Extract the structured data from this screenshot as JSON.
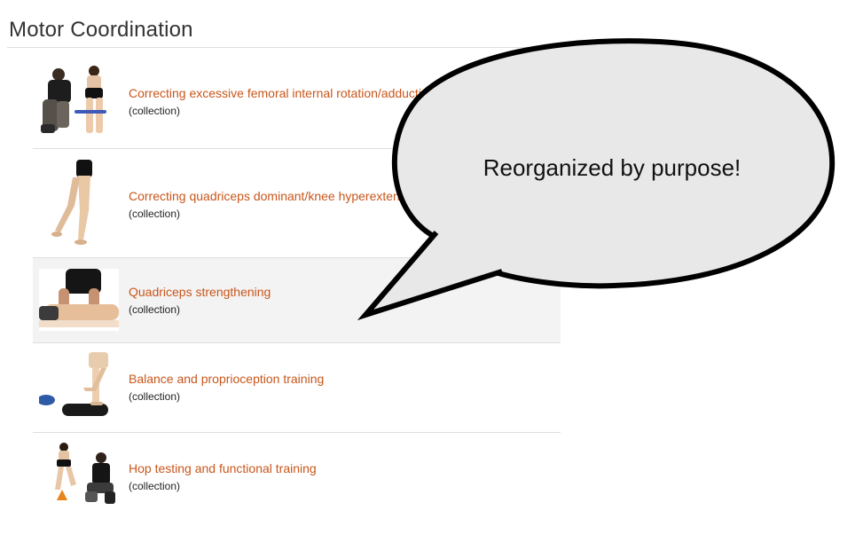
{
  "section": {
    "title": "Motor Coordination"
  },
  "items": [
    {
      "title": "Correcting excessive femoral internal rotation/adduction",
      "subtitle": "(collection)",
      "icon": "therapist-band-exercise-thumbnail"
    },
    {
      "title": "Correcting quadriceps dominant/knee hyperextension",
      "subtitle": "(collection)",
      "icon": "leg-walking-thumbnail"
    },
    {
      "title": "Quadriceps strengthening",
      "subtitle": "(collection)",
      "icon": "therapist-leg-massage-thumbnail"
    },
    {
      "title": "Balance and proprioception training",
      "subtitle": "(collection)",
      "icon": "balance-pad-thumbnail"
    },
    {
      "title": "Hop testing and functional training",
      "subtitle": "(collection)",
      "icon": "hop-testing-thumbnail"
    }
  ],
  "callout": {
    "text": "Reorganized by purpose!"
  },
  "colors": {
    "link": "#c8561b",
    "bubble_fill": "#e8e8e8",
    "bubble_stroke": "#000000",
    "highlight_row": "#f3f3f3"
  }
}
